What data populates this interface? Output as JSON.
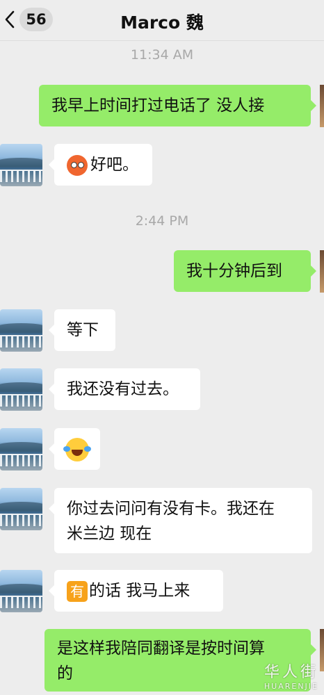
{
  "header": {
    "unread_count": "56",
    "contact_name": "Marco 魏"
  },
  "timestamps": [
    "11:34 AM",
    "2:44 PM"
  ],
  "messages": [
    {
      "side": "out",
      "text": "我早上时间打过电话了 没人接"
    },
    {
      "side": "in",
      "emoji": "worried-face",
      "text": "好吧。"
    },
    {
      "side": "out",
      "text": "我十分钟后到"
    },
    {
      "side": "in",
      "text": "等下"
    },
    {
      "side": "in",
      "text": "我还没有过去。"
    },
    {
      "side": "in",
      "emoji": "laughing-tears-face",
      "text": ""
    },
    {
      "side": "in",
      "line1": "你过去问问有没有卡。我还在",
      "line2": "米兰边 现在"
    },
    {
      "side": "in",
      "emoji_char": "有",
      "text": "的话 我马上来"
    },
    {
      "side": "out",
      "line1": "是这样我陪同翻译是按时间算",
      "line2": "的"
    }
  ],
  "watermark": {
    "cn": "华人街",
    "en": "HUARENJIE"
  },
  "colors": {
    "background": "#ededed",
    "outgoing_bubble": "#95ec69",
    "incoming_bubble": "#ffffff"
  }
}
